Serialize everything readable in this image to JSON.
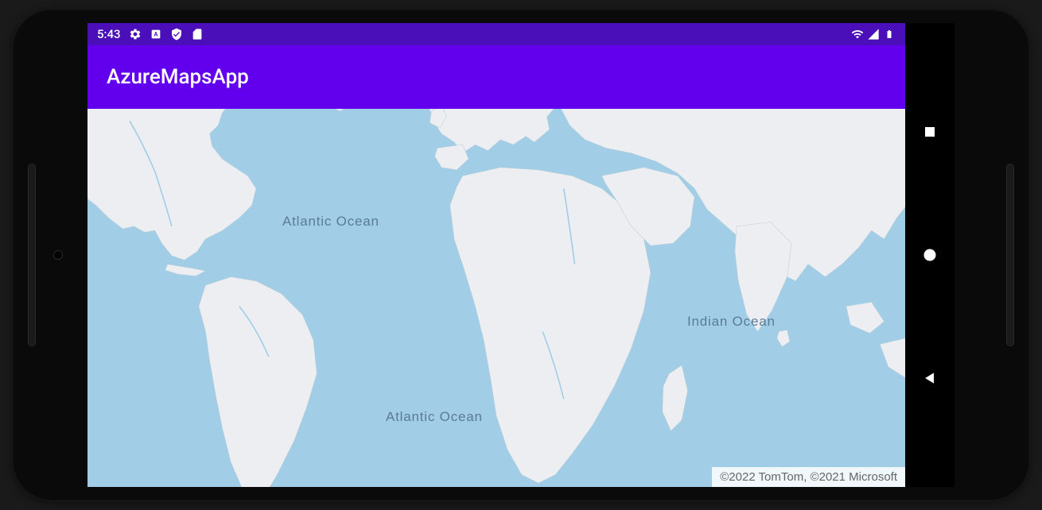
{
  "status_bar": {
    "time": "5:43",
    "icons": {
      "gear": "gear-icon",
      "app_badge": "app-badge-icon",
      "shield": "shield-icon",
      "sd_card": "sd-card-icon",
      "wifi": "wifi-icon",
      "signal": "signal-icon",
      "battery": "battery-icon"
    }
  },
  "app_bar": {
    "title": "AzureMapsApp"
  },
  "map": {
    "labels": {
      "atlantic_north": "Atlantic Ocean",
      "atlantic_south": "Atlantic Ocean",
      "indian": "Indian Ocean"
    },
    "attribution": "©2022 TomTom, ©2021 Microsoft",
    "colors": {
      "water": "#a1cde6",
      "land": "#eceef2",
      "label": "#5b7a99"
    }
  },
  "nav_buttons": {
    "recents": "square",
    "home": "circle",
    "back": "triangle"
  },
  "theme": {
    "primary": "#6200EE",
    "primary_dark": "#4A0FB8"
  }
}
